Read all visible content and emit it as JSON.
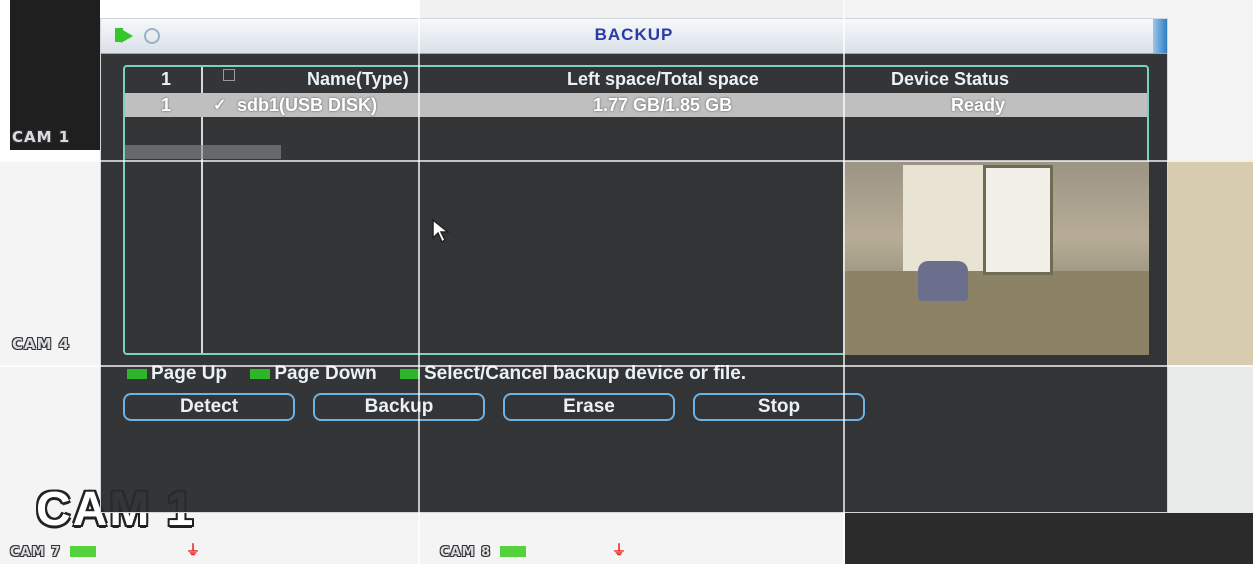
{
  "background": {
    "cam_labels": [
      "CAM 1",
      "CAM 4",
      "CAM 7",
      "CAM 8"
    ],
    "big_label": "CAM 1"
  },
  "dialog": {
    "title": "BACKUP",
    "table": {
      "headers": [
        "1",
        "Name(Type)",
        "Left space/Total space",
        "Device Status"
      ],
      "rows": [
        {
          "index": "1",
          "checked": true,
          "name": "sdb1(USB DISK)",
          "space": "1.77 GB/1.85 GB",
          "status": "Ready"
        }
      ]
    },
    "hints": [
      "Page Up",
      "Page Down",
      "Select/Cancel backup device or file."
    ],
    "buttons": [
      "Detect",
      "Backup",
      "Erase",
      "Stop"
    ]
  },
  "colors": {
    "title": "#2a3aa8",
    "frame": "#7ed1bf",
    "button_border": "#6fb2e3",
    "hint_key": "#2fb52a"
  }
}
